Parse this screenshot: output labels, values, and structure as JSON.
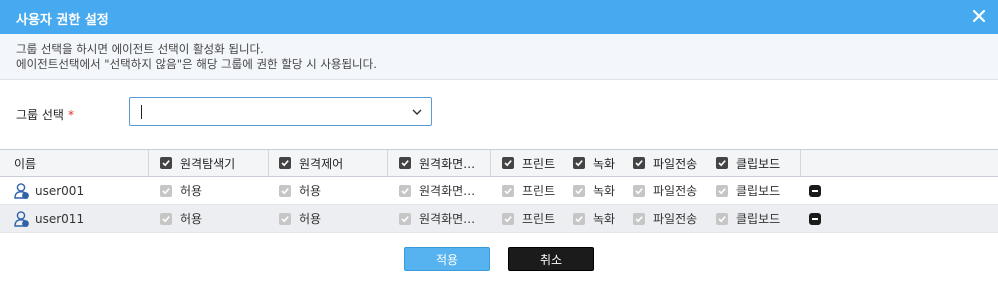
{
  "dialog": {
    "title": "사용자 권한 설정",
    "close_icon": "close-icon"
  },
  "info": {
    "line1": "그룹 선택을 하시면 에이전트 선택이 활성화 됩니다.",
    "line2": "에이전트선택에서 \"선택하지 않음\"은 해당 그룹에 권한 할당 시 사용됩니다."
  },
  "group": {
    "label": "그룹 선택",
    "required_mark": "*",
    "value": ""
  },
  "table": {
    "name_header": "이름",
    "columns": [
      "원격탐색기",
      "원격제어",
      "원격화면…",
      "프린트",
      "녹화",
      "파일전송",
      "클립보드"
    ],
    "rows": [
      {
        "user": "user001",
        "values": [
          "허용",
          "허용",
          "원격화면…",
          "프린트",
          "녹화",
          "파일전송",
          "클립보드"
        ]
      },
      {
        "user": "user011",
        "values": [
          "허용",
          "허용",
          "원격화면…",
          "프린트",
          "녹화",
          "파일전송",
          "클립보드"
        ]
      }
    ]
  },
  "buttons": {
    "apply": "적용",
    "cancel": "취소"
  },
  "colors": {
    "titlebar": "#47a9ef",
    "apply_button": "#56b3f0",
    "cancel_button": "#1b1b1b",
    "required": "#e0302a"
  }
}
